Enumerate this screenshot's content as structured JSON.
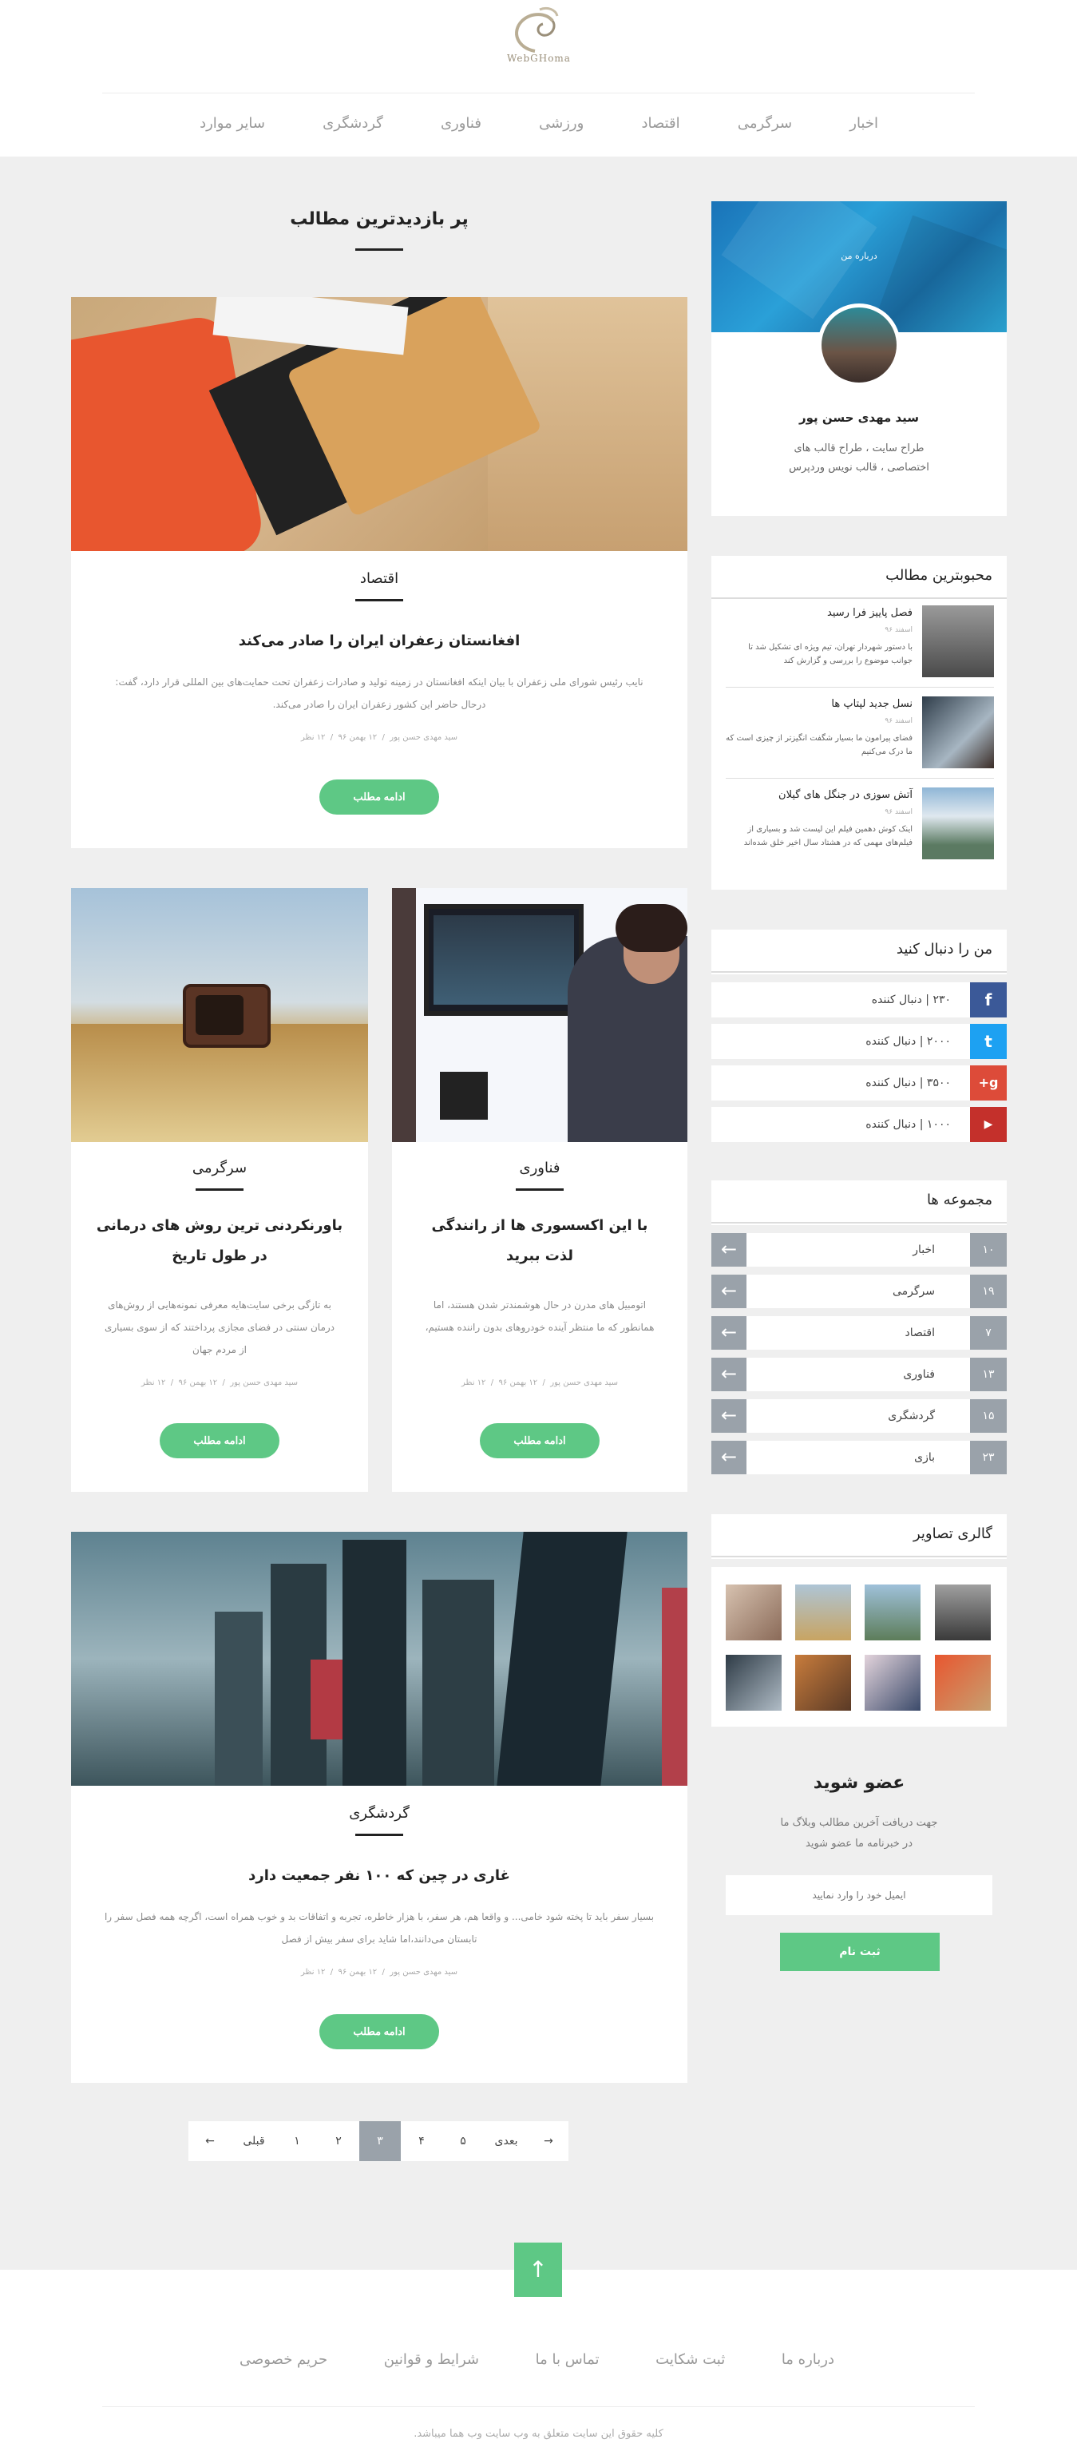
{
  "header": {
    "logo_text": "WebGHoma",
    "nav": [
      "اخبار",
      "سرگرمی",
      "اقتصاد",
      "ورزشی",
      "فناوری",
      "گردشگری",
      "سایر موارد"
    ]
  },
  "main": {
    "heading": "پر بازدیدترین مطالب",
    "read_more": "ادامه مطلب",
    "posts": [
      {
        "category": "اقتصاد",
        "title": "افغانستان زعفران ایران را صادر می‌کند",
        "excerpt": "نایب رئیس شورای ملی زعفران با بیان اینکه افغانستان در زمینه تولید و صادرات زعفران تحت حمایت‌های بین المللی قرار دارد، گفت: درحال حاضر این کشور زعفران ایران را صادر می‌کند.",
        "author": "سید مهدی حسن پور",
        "date": "۱۲ بهمن ۹۶",
        "views": "۱۲ نظر"
      },
      {
        "category": "فناوری",
        "title": "با این اکسسوری ها از رانندگی لذت ببرید",
        "excerpt": "اتومبیل های مدرن در حال هوشمندتر شدن هستند، اما همانطور که ما منتظر آینده خودروهای بدون راننده هستیم،",
        "author": "سید مهدی حسن پور",
        "date": "۱۲ بهمن ۹۶",
        "views": "۱۲ نظر"
      },
      {
        "category": "سرگرمی",
        "title": "باورنکردنی ترین روش های درمانی در طول تاریخ",
        "excerpt": "به تازگی برخی سایت‌هایه معرفی نمونه‌هایی از روش‌های درمان سنتی در فضای مجازی پرداختند که از سوی بسیاری از مردم جهان",
        "author": "سید مهدی حسن پور",
        "date": "۱۲ بهمن ۹۶",
        "views": "۱۲ نظر"
      },
      {
        "category": "گردشگری",
        "title": "غاری در چین که ۱۰۰ نفر جمعیت دارد",
        "excerpt": "بسیار سفر باید تا پخته شود خامی... و واقعا هم، هر سفر، با هزار خاطره، تجربه و اتفاقات بد و خوب همراه است، اگرچه همه فصل سفر را تابستان می‌دانند،اما شاید برای سفر بیش از فصل",
        "author": "سید مهدی حسن پور",
        "date": "۱۲ بهمن ۹۶",
        "views": "۱۲ نظر"
      }
    ],
    "pagination": {
      "next": "بعدی",
      "prev": "قبلی",
      "pages": [
        "۵",
        "۴",
        "۳",
        "۲",
        "۱"
      ],
      "current": "۳"
    }
  },
  "sidebar": {
    "about": {
      "label": "درباره من",
      "name": "سید مهدی حسن پور",
      "bio": "طراح سایت ، طراح قالب های اختصاصی ، قالب نویس وردپرس"
    },
    "popular": {
      "title": "محبوبترین مطالب",
      "items": [
        {
          "title": "فصل پاییز فرا رسید",
          "date": "اسفند ۹۶",
          "excerpt": "با دستور شهردار تهران، تیم ویژه ای تشکیل شد تا جوانب موضوع را بررسی و گزارش کند"
        },
        {
          "title": "نسل جدید لپتاپ ها",
          "date": "اسفند ۹۶",
          "excerpt": "فضای پیرامون ما بسیار شگفت انگیزتر از چیزی است که ما درک می‌کنیم"
        },
        {
          "title": "آتش سوزی در جنگل های گیلان",
          "date": "اسفند ۹۶",
          "excerpt": "اینک کوش دهمین فیلم این لیست شد و بسیاری از فیلم‌های مهمی که در هشتاد سال اخیر خلق شده‌اند"
        }
      ]
    },
    "follow": {
      "title": "من را دنبال کنید",
      "items": [
        {
          "count": "۲۳۰ | دنبال کننده",
          "color": "#3b5998",
          "glyph": "f",
          "icon": "facebook-icon"
        },
        {
          "count": "۲۰۰۰ | دنبال کننده",
          "color": "#1da1f2",
          "glyph": "t",
          "icon": "twitter-icon"
        },
        {
          "count": "۳۵۰۰ | دنبال کننده",
          "color": "#dd4b39",
          "glyph": "g+",
          "icon": "googleplus-icon"
        },
        {
          "count": "۱۰۰۰ | دنبال کننده",
          "color": "#c4302b",
          "glyph": "▶",
          "icon": "youtube-icon"
        }
      ]
    },
    "categories": {
      "title": "مجموعه ها",
      "items": [
        {
          "name": "اخبار",
          "count": "۱۰"
        },
        {
          "name": "سرگرمی",
          "count": "۱۹"
        },
        {
          "name": "اقتصاد",
          "count": "۷"
        },
        {
          "name": "فناوری",
          "count": "۱۳"
        },
        {
          "name": "گردشگری",
          "count": "۱۵"
        },
        {
          "name": "بازی",
          "count": "۲۳"
        }
      ]
    },
    "gallery": {
      "title": "گالری تصاویر"
    },
    "subscribe": {
      "title": "عضو شوید",
      "text": "جهت دریافت آخرین مطالب وبلاگ ما در خبرنامه ما عضو شوید",
      "placeholder": "ایمیل خود را وارد نمایید",
      "button": "ثبت نام"
    }
  },
  "footer": {
    "links": [
      "درباره ما",
      "ثبت شکایت",
      "تماس با ما",
      "شرایط و قوانین",
      "حریم خصوصی"
    ],
    "copyright": "کلیه حقوق این سایت متعلق به وب سایت وب هما میباشد."
  }
}
